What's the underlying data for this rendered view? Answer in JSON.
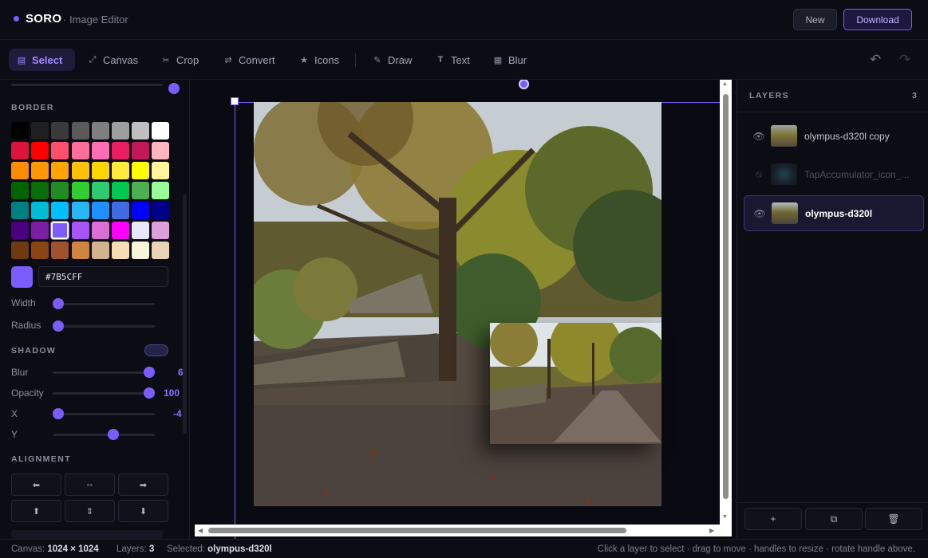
{
  "app": {
    "name": "SORO",
    "subtitle": "· Image Editor"
  },
  "header": {
    "new_label": "New",
    "download_label": "Download"
  },
  "toolbar": {
    "tools": [
      {
        "id": "select",
        "label": "Select",
        "icon": "select-icon",
        "active": true
      },
      {
        "id": "canvas",
        "label": "Canvas",
        "icon": "resize-icon"
      },
      {
        "id": "crop",
        "label": "Crop",
        "icon": "scissors-icon"
      },
      {
        "id": "convert",
        "label": "Convert",
        "icon": "swap-icon"
      },
      {
        "id": "icons",
        "label": "Icons",
        "icon": "star-icon"
      },
      {
        "id": "draw",
        "label": "Draw",
        "icon": "pencil-icon"
      },
      {
        "id": "text",
        "label": "Text",
        "icon": "text-icon"
      },
      {
        "id": "blur",
        "label": "Blur",
        "icon": "blur-icon"
      }
    ],
    "undo_icon": "undo-icon",
    "redo_icon": "redo-icon"
  },
  "left_panel": {
    "border_title": "BORDER",
    "palette": [
      [
        "#000000",
        "#1f1f1f",
        "#3a3a3a",
        "#5a5a5a",
        "#7f7f7f",
        "#9e9e9e",
        "#bfbfbf",
        "#ffffff"
      ],
      [
        "#dc143c",
        "#ff0000",
        "#ff4f6d",
        "#ff6f9c",
        "#ff6eb4",
        "#e91e63",
        "#c2185b",
        "#ffb6c1"
      ],
      [
        "#ff8c00",
        "#ff9800",
        "#ffa500",
        "#ffc107",
        "#ffd700",
        "#ffeb3b",
        "#ffff00",
        "#fff59d"
      ],
      [
        "#006400",
        "#0a6e0a",
        "#228b22",
        "#32cd32",
        "#2ecc71",
        "#00c853",
        "#4caf50",
        "#98fb98"
      ],
      [
        "#008080",
        "#00bcd4",
        "#00bfff",
        "#29b6f6",
        "#1e90ff",
        "#4169e1",
        "#0000ff",
        "#00008b"
      ],
      [
        "#4b0082",
        "#7b1fa2",
        "#7b5cff",
        "#a855f7",
        "#da70d6",
        "#ff00ff",
        "#e6e6fa",
        "#dda0dd"
      ],
      [
        "#6d3a12",
        "#8b4513",
        "#a0522d",
        "#cd853f",
        "#d2b48c",
        "#f5deb3",
        "#f5f5dc",
        "#e8d5b7"
      ]
    ],
    "selected_swatch": "#7B5CFF",
    "hex_value": "#7B5CFF",
    "width_label": "Width",
    "width_value": 0,
    "radius_label": "Radius",
    "radius_value": 0,
    "shadow_title": "SHADOW",
    "shadow_enabled": true,
    "blur_label": "Blur",
    "blur_value": "6",
    "opacity_label": "Opacity",
    "opacity_value": "100",
    "x_label": "X",
    "x_value": "-4",
    "y_label": "Y",
    "alignment_title": "ALIGNMENT",
    "alignment_icons": [
      "align-left-icon",
      "align-center-h-icon",
      "align-right-icon",
      "align-top-icon",
      "align-center-v-icon",
      "align-bottom-icon"
    ]
  },
  "layers": {
    "title": "LAYERS",
    "count": "3",
    "items": [
      {
        "name": "olympus-d320l copy",
        "visible": true,
        "selected": false
      },
      {
        "name": "TapAccumulator_icon_...",
        "visible": false,
        "selected": false
      },
      {
        "name": "olympus-d320l",
        "visible": true,
        "selected": true
      }
    ],
    "action_icons": [
      "add-layer-icon",
      "duplicate-layer-icon",
      "delete-layer-icon"
    ],
    "add_label": "+"
  },
  "status": {
    "canvas_label": "Canvas:",
    "canvas_value": "1024 × 1024",
    "layers_label": "Layers:",
    "layers_value": "3",
    "selected_label": "Selected:",
    "selected_value": "olympus-d320l",
    "hint": "Click a layer to select · drag to move · handles to resize · rotate handle above."
  },
  "colors": {
    "accent": "#7b5cff",
    "background": "#0a0b12",
    "panel": "#0c0d14"
  }
}
